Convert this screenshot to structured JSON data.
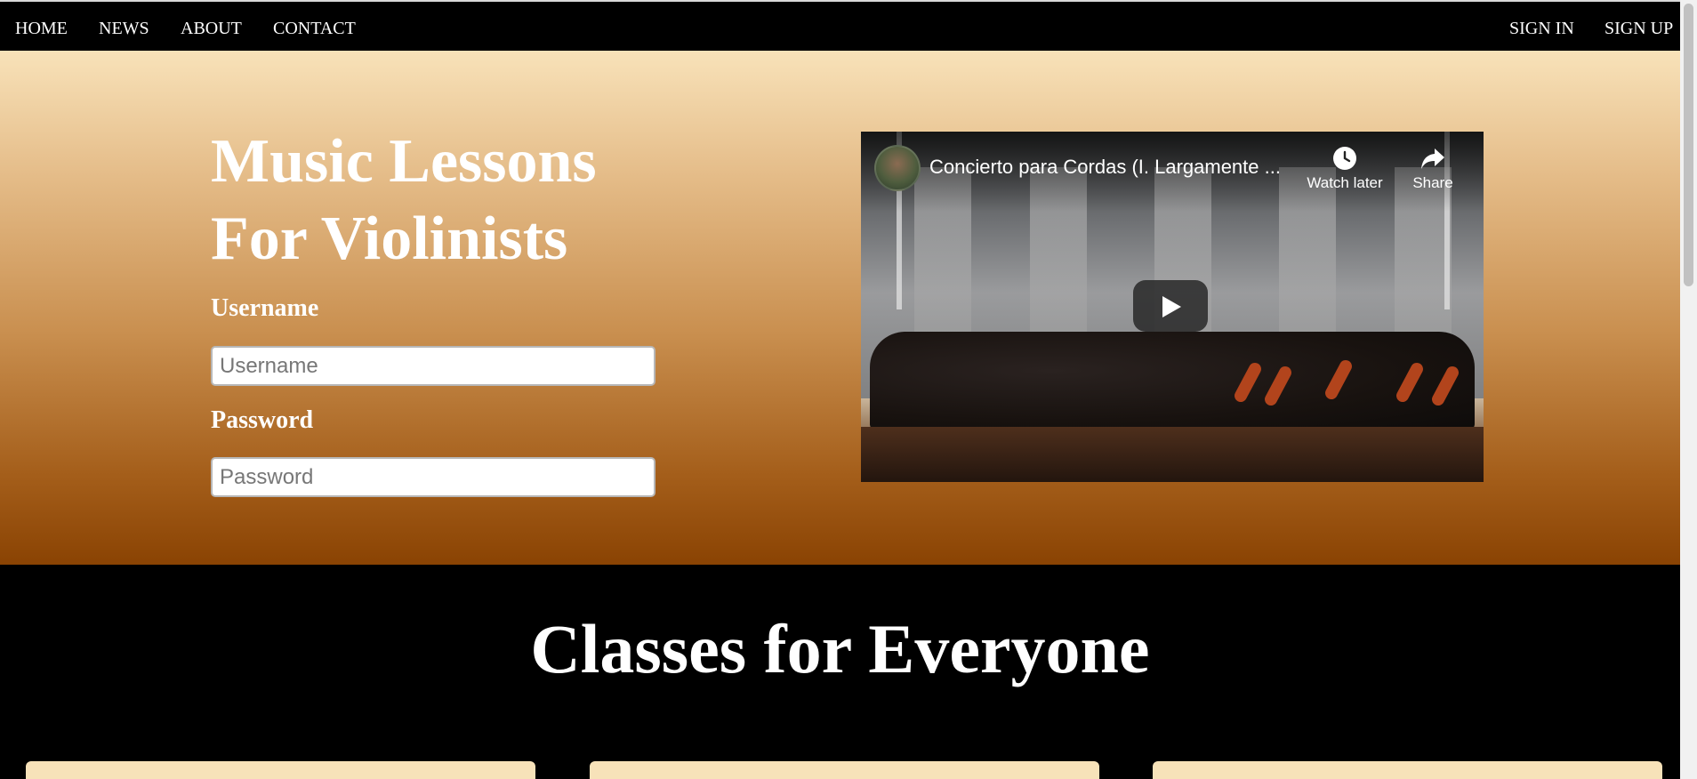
{
  "nav": {
    "left": [
      "HOME",
      "NEWS",
      "ABOUT",
      "CONTACT"
    ],
    "right": [
      "SIGN IN",
      "SIGN UP"
    ]
  },
  "hero": {
    "title_line1": "Music Lessons",
    "title_line2": "For Violinists",
    "username_label": "Username",
    "username_placeholder": "Username",
    "password_label": "Password",
    "password_placeholder": "Password"
  },
  "video": {
    "title": "Concierto para Cordas (I. Largamente ...",
    "watch_later_label": "Watch later",
    "share_label": "Share",
    "icons": {
      "watch_later": "clock-icon",
      "share": "share-arrow-icon",
      "play": "play-icon"
    }
  },
  "classes": {
    "heading": "Classes for Everyone",
    "card_count": 3
  },
  "colors": {
    "nav_background": "#000000",
    "hero_gradient_top": "#f8e2b9",
    "hero_gradient_bottom": "#8a4303",
    "section_background": "#000000",
    "card_background": "#f7e2b9",
    "text_light": "#ffffff"
  }
}
